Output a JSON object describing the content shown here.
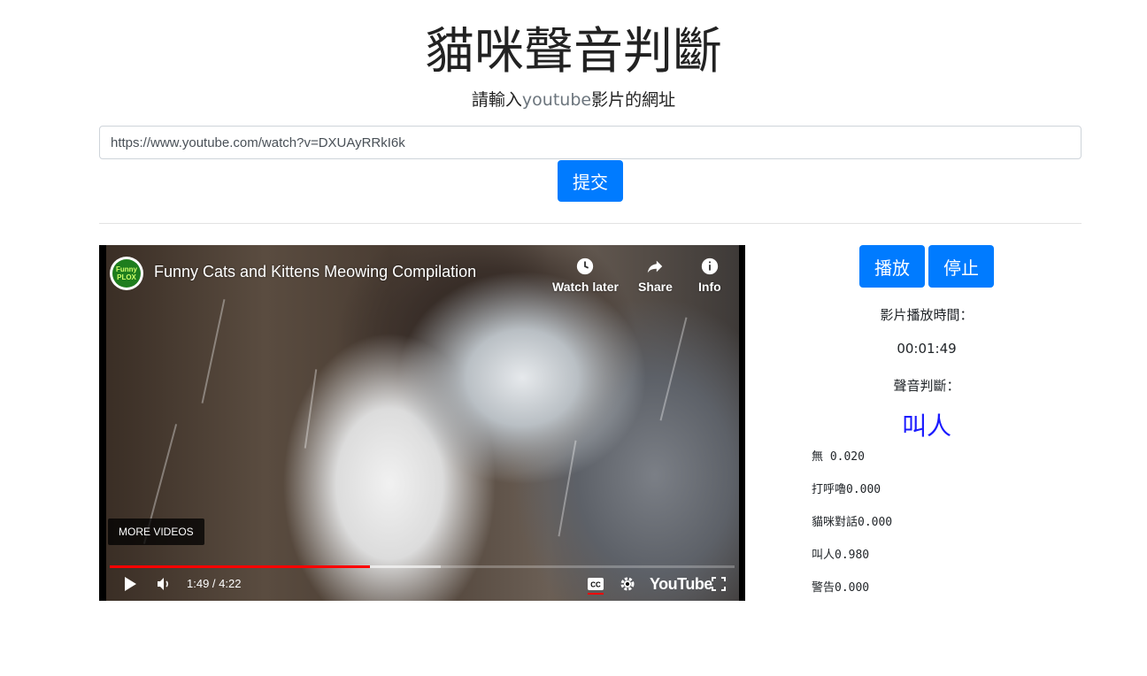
{
  "page": {
    "title": "貓咪聲音判斷",
    "subtitle_before": "請輸入",
    "subtitle_word": "youtube",
    "subtitle_after": "影片的網址"
  },
  "form": {
    "url_value": "https://www.youtube.com/watch?v=DXUAyRRkI6k",
    "submit_label": "提交"
  },
  "video": {
    "channel_logo_text": "Funny PLOX",
    "title": "Funny Cats and Kittens Meowing Compilation",
    "actions": [
      {
        "label": "Watch later",
        "icon": "clock-icon"
      },
      {
        "label": "Share",
        "icon": "share-icon"
      },
      {
        "label": "Info",
        "icon": "info-icon"
      }
    ],
    "more_videos_label": "MORE VIDEOS",
    "time_display": "1:49 / 4:22",
    "played_fraction": 0.417,
    "buffered_fraction": 0.53,
    "brand": "YouTube",
    "controls": [
      "play-icon",
      "volume-icon",
      "cc-icon",
      "gear-icon",
      "fullscreen-icon"
    ]
  },
  "panel": {
    "play_label": "播放",
    "stop_label": "停止",
    "playback_time_label": "影片播放時間：",
    "playback_time_value": "00:01:49",
    "judgement_label": "聲音判斷：",
    "judgement_result": "叫人",
    "probabilities": [
      {
        "text": "無 0.020"
      },
      {
        "text": "打呼嚕0.000"
      },
      {
        "text": "貓咪對話0.000"
      },
      {
        "text": "叫人0.980"
      },
      {
        "text": "警告0.000"
      }
    ]
  },
  "colors": {
    "primary": "#007bff",
    "result": "#1a1aff",
    "progress": "#ff0000"
  }
}
